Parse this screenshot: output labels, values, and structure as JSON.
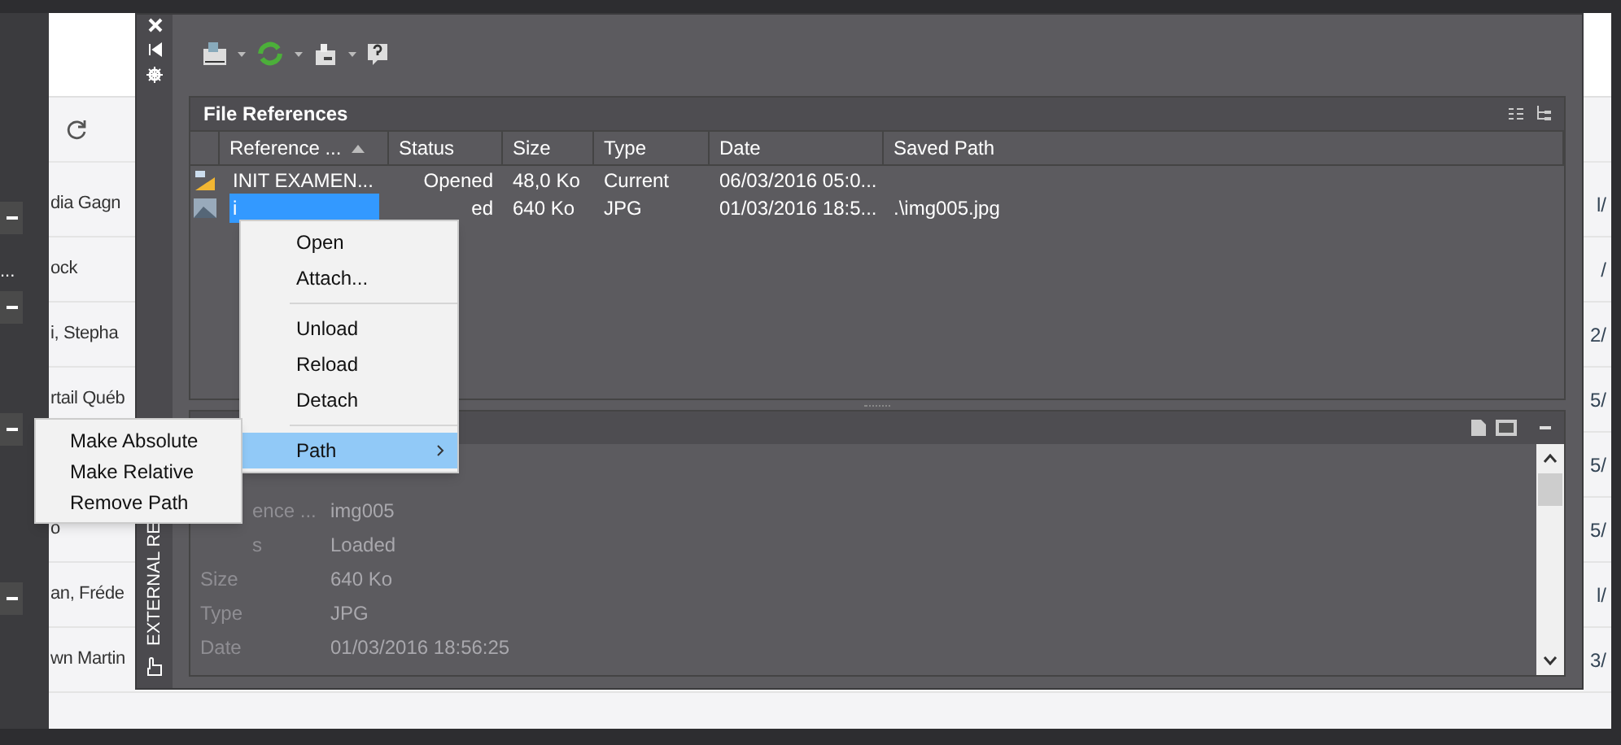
{
  "left_strip": [
    {
      "kind": "minus"
    },
    {
      "kind": "dots",
      "text": "..."
    },
    {
      "kind": "minus"
    },
    {
      "kind": "minus"
    },
    {
      "kind": "minus"
    }
  ],
  "background_page": {
    "rows": [
      {
        "kind": "name",
        "text": "dia Gagn",
        "fragment": "l/"
      },
      {
        "kind": "name",
        "text": "ock",
        "fragment": "/"
      },
      {
        "kind": "name",
        "text": "i, Stepha",
        "fragment": "2/"
      },
      {
        "kind": "name",
        "text": "rtail Québ",
        "fragment": "5/"
      },
      {
        "kind": "covered",
        "fragment": "5/"
      },
      {
        "kind": "name",
        "text": "o",
        "fragment": "5/"
      },
      {
        "kind": "name",
        "text": "an, Fréde",
        "fragment": "l/"
      },
      {
        "kind": "name",
        "text": "wn Martin",
        "fragment": "3/"
      }
    ]
  },
  "palette": {
    "side_title": "EXTERNAL RE",
    "file_references": {
      "title": "File References",
      "columns": [
        {
          "label": "Reference ...",
          "sorted": true
        },
        {
          "label": "Status",
          "sorted": false
        },
        {
          "label": "Size",
          "sorted": false
        },
        {
          "label": "Type",
          "sorted": false
        },
        {
          "label": "Date",
          "sorted": false
        },
        {
          "label": "Saved Path",
          "sorted": false
        }
      ],
      "rows": [
        {
          "kind": "drawing",
          "selected": false,
          "cells": [
            "INIT EXAMEN...",
            "Opened",
            "48,0 Ko",
            "Current",
            "06/03/2016 05:0...",
            ""
          ]
        },
        {
          "kind": "image",
          "selected": true,
          "cells": [
            "i",
            "ed",
            "640 Ko",
            "JPG",
            "01/03/2016 18:5...",
            ".\\img005.jpg"
          ]
        }
      ]
    },
    "details": {
      "rows": [
        {
          "label": "ence ...",
          "label_cut": true,
          "value": "img005"
        },
        {
          "label": "s",
          "label_cut": true,
          "value": "Loaded"
        },
        {
          "label": "Size",
          "label_cut": false,
          "value": "640 Ko"
        },
        {
          "label": "Type",
          "label_cut": false,
          "value": "JPG"
        },
        {
          "label": "Date",
          "label_cut": false,
          "value": "01/03/2016 18:56:25"
        }
      ]
    }
  },
  "context_menu": {
    "items": [
      {
        "kind": "item",
        "label": "Open",
        "selected": false
      },
      {
        "kind": "item",
        "label": "Attach...",
        "selected": false
      },
      {
        "kind": "separator"
      },
      {
        "kind": "item",
        "label": "Unload",
        "selected": false
      },
      {
        "kind": "item",
        "label": "Reload",
        "selected": false
      },
      {
        "kind": "item",
        "label": "Detach",
        "selected": false
      },
      {
        "kind": "separator"
      },
      {
        "kind": "submenu",
        "label": "Path",
        "selected": true
      }
    ]
  },
  "submenu": {
    "items": [
      "Make Absolute",
      "Make Relative",
      "Remove Path"
    ]
  }
}
